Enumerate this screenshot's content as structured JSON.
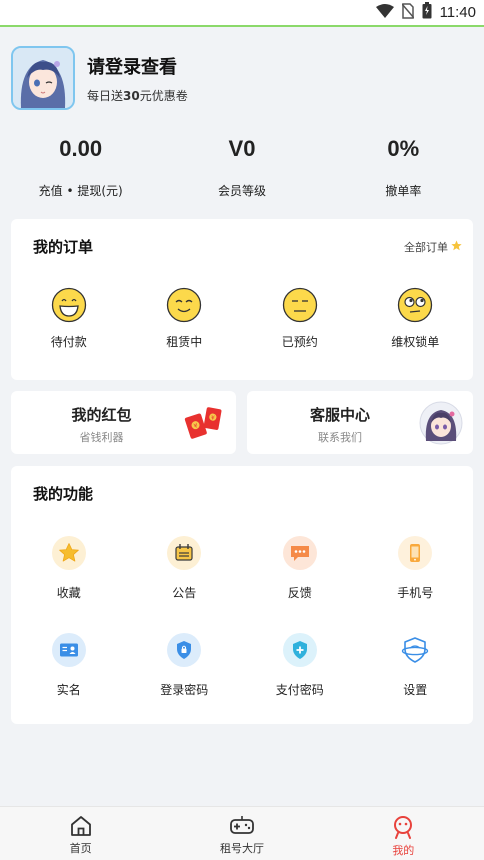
{
  "status_bar": {
    "time": "11:40"
  },
  "profile": {
    "title": "请登录查看",
    "sub_prefix": "每日送",
    "sub_amount": "30",
    "sub_suffix": "元优惠卷"
  },
  "stats": [
    {
      "value": "0.00",
      "label": "充值 • 提现(元)"
    },
    {
      "value": "V0",
      "label": "会员等级"
    },
    {
      "value": "0%",
      "label": "撤单率"
    }
  ],
  "orders": {
    "title": "我的订单",
    "all_label": "全部订单",
    "items": [
      {
        "label": "待付款",
        "icon": "grin-face-icon"
      },
      {
        "label": "租赁中",
        "icon": "smile-face-icon"
      },
      {
        "label": "已预约",
        "icon": "neutral-face-icon"
      },
      {
        "label": "维权锁单",
        "icon": "rolling-eyes-face-icon"
      }
    ]
  },
  "red_packet": {
    "title": "我的红包",
    "sub": "省钱利器"
  },
  "service": {
    "title": "客服中心",
    "sub": "联系我们"
  },
  "features": {
    "title": "我的功能",
    "items": [
      {
        "label": "收藏",
        "icon": "star-icon"
      },
      {
        "label": "公告",
        "icon": "notice-icon"
      },
      {
        "label": "反馈",
        "icon": "feedback-icon"
      },
      {
        "label": "手机号",
        "icon": "phone-icon"
      },
      {
        "label": "实名",
        "icon": "id-card-icon"
      },
      {
        "label": "登录密码",
        "icon": "shield-lock-icon"
      },
      {
        "label": "支付密码",
        "icon": "shield-plus-icon"
      },
      {
        "label": "设置",
        "icon": "settings-icon"
      }
    ]
  },
  "tabs": [
    {
      "label": "首页",
      "icon": "home-icon"
    },
    {
      "label": "租号大厅",
      "icon": "gamepad-icon"
    },
    {
      "label": "我的",
      "icon": "mine-icon",
      "active": true
    }
  ],
  "colors": {
    "accent": "#e8423c",
    "primary_blue": "#3a8ee6",
    "emoji_yellow": "#fcd94b"
  }
}
